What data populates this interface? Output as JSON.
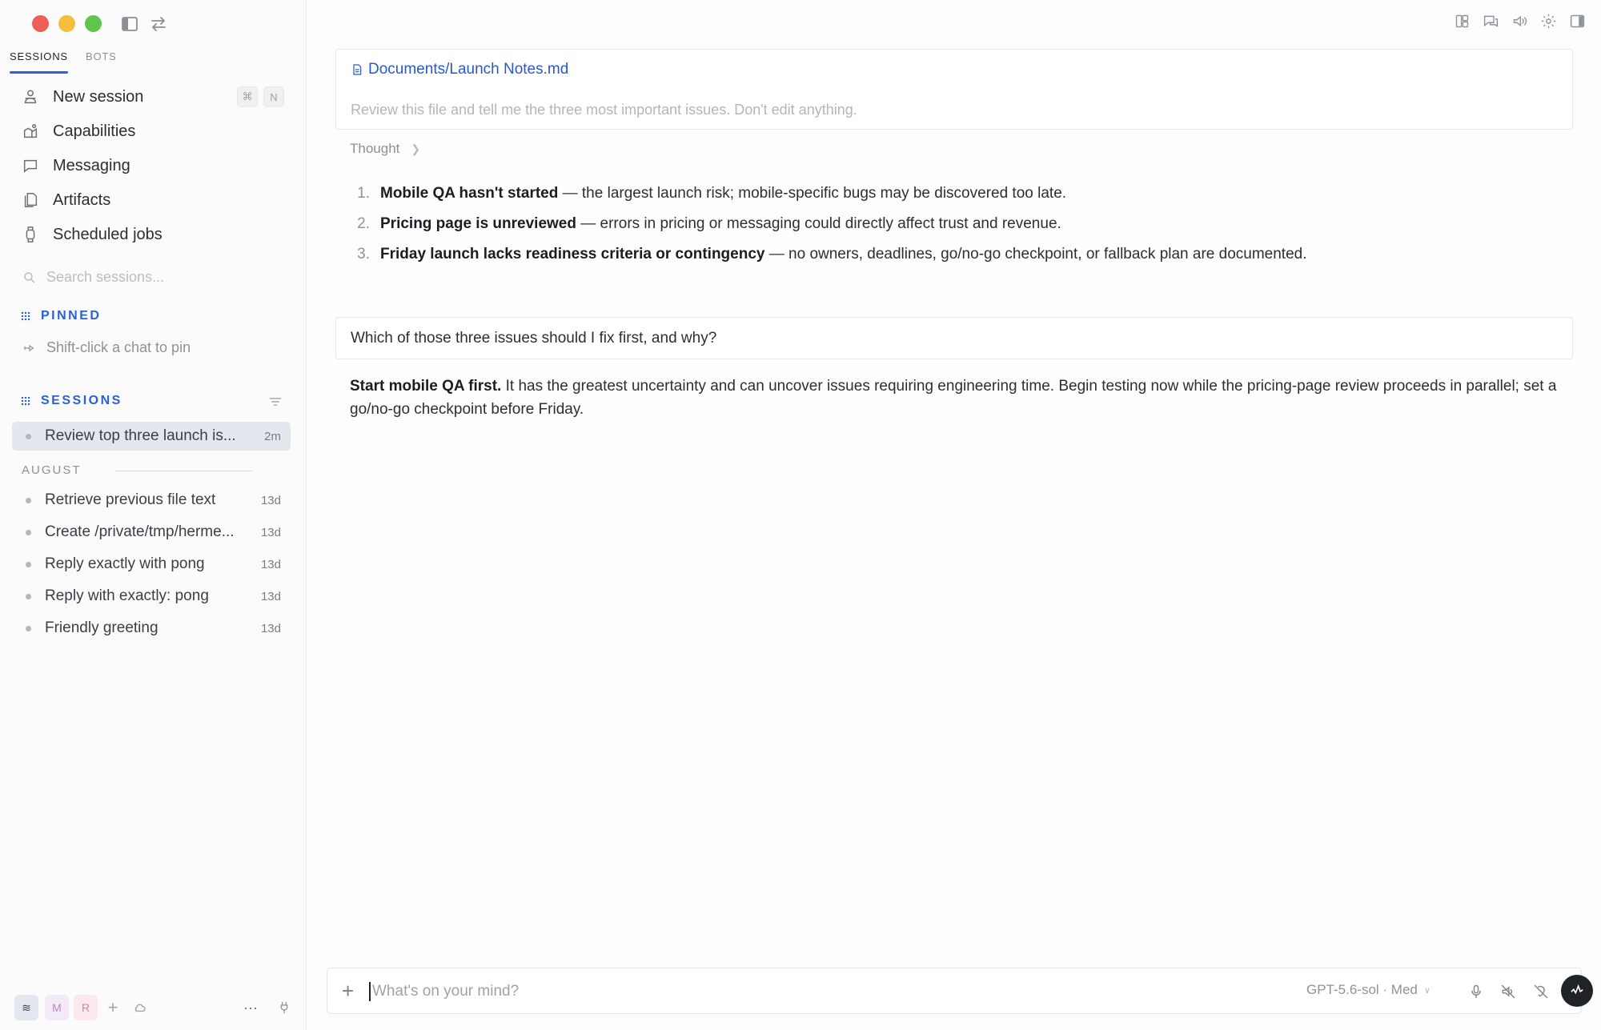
{
  "sidebar": {
    "tabs": [
      {
        "label": "SESSIONS",
        "active": true
      },
      {
        "label": "BOTS",
        "active": false
      }
    ],
    "nav": [
      {
        "label": "New session",
        "icon": "new-session-icon"
      },
      {
        "label": "Capabilities",
        "icon": "capabilities-icon"
      },
      {
        "label": "Messaging",
        "icon": "chat-bubble-icon"
      },
      {
        "label": "Artifacts",
        "icon": "documents-icon"
      },
      {
        "label": "Scheduled jobs",
        "icon": "watch-icon"
      }
    ],
    "shortcut": {
      "modifier": "⌘",
      "key": "N"
    },
    "search_placeholder": "Search sessions...",
    "pinned": {
      "heading": "PINNED",
      "hint": "Shift-click a chat to pin"
    },
    "sessions": {
      "heading": "SESSIONS",
      "current": [
        {
          "title": "Review top three launch is...",
          "age": "2m",
          "active": true
        }
      ],
      "groups": [
        {
          "label": "AUGUST",
          "items": [
            {
              "title": "Retrieve previous file text",
              "age": "13d"
            },
            {
              "title": "Create /private/tmp/herme...",
              "age": "13d"
            },
            {
              "title": "Reply exactly with pong",
              "age": "13d"
            },
            {
              "title": "Reply with exactly: pong",
              "age": "13d"
            },
            {
              "title": "Friendly greeting",
              "age": "13d"
            }
          ]
        }
      ]
    },
    "workspaces": {
      "main": "≋",
      "m": "M",
      "r": "R",
      "add": "+",
      "more": "···"
    }
  },
  "conversation": {
    "file_attachment": {
      "path": "Documents/Launch Notes.md",
      "prompt": "Review this file and tell me the three most important issues. Don't edit anything."
    },
    "thought_label": "Thought",
    "answer_items": [
      {
        "num": "1.",
        "bold": "Mobile QA hasn't started",
        "rest": " — the largest launch risk; mobile-specific bugs may be discovered too late."
      },
      {
        "num": "2.",
        "bold": "Pricing page is unreviewed",
        "rest": " — errors in pricing or messaging could directly affect trust and revenue."
      },
      {
        "num": "3.",
        "bold": "Friday launch lacks readiness criteria or contingency",
        "rest": " — no owners, deadlines, go/no-go checkpoint, or fallback plan are documented."
      }
    ],
    "question": "Which of those three issues should I fix first, and why?",
    "reply": {
      "bold": "Start mobile QA first.",
      "rest": " It has the greatest uncertainty and can uncover issues requiring engineering time. Begin testing now while the pricing-page review proceeds in parallel; set a go/no-go checkpoint before Friday."
    }
  },
  "composer": {
    "placeholder": "What's on your mind?",
    "value": "",
    "model": "GPT-5.6-sol · Med"
  },
  "colors": {
    "accent": "#2b5fd9",
    "link": "#2a58c9",
    "active_session_bg": "#e4e7ee",
    "send_button": "#1f2226"
  }
}
